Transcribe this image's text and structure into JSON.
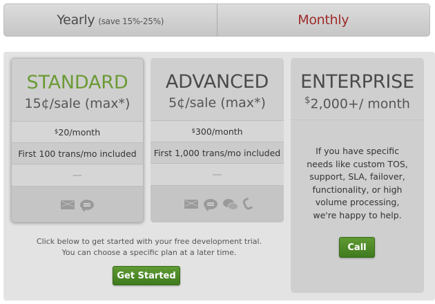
{
  "billing_toggle": {
    "yearly_label": "Yearly",
    "yearly_note": "(save 15%-25%)",
    "monthly_label": "Monthly"
  },
  "plans": [
    {
      "name": "STANDARD",
      "rate": "15¢/sale (max*)",
      "fee_symbol": "$",
      "fee": "20/month",
      "included": "First 100 trans/mo included",
      "extra": "—",
      "support_icons": [
        "email-icon",
        "chat-icon"
      ]
    },
    {
      "name": "ADVANCED",
      "rate": "5¢/sale (max*)",
      "fee_symbol": "$",
      "fee": "300/month",
      "included": "First 1,000 trans/mo included",
      "extra": "—",
      "support_icons": [
        "email-icon",
        "chat-icon",
        "forum-icon",
        "phone-icon"
      ]
    },
    {
      "name": "ENTERPRISE",
      "rate_symbol": "$",
      "rate": "2,000+/ month",
      "description": "If you have specific needs like custom TOS, support, SLA, failover, functionality, or high volume processing, we're happy to help.",
      "cta": "Call"
    }
  ],
  "trial": {
    "line1": "Click below to get started with your free development trial.",
    "line2": "You can choose a specific plan at a later time.",
    "button": "Get Started"
  },
  "colors": {
    "accent_green": "#6b9a35",
    "button_green": "#4b8726",
    "monthly_red": "#9e2a2a"
  }
}
